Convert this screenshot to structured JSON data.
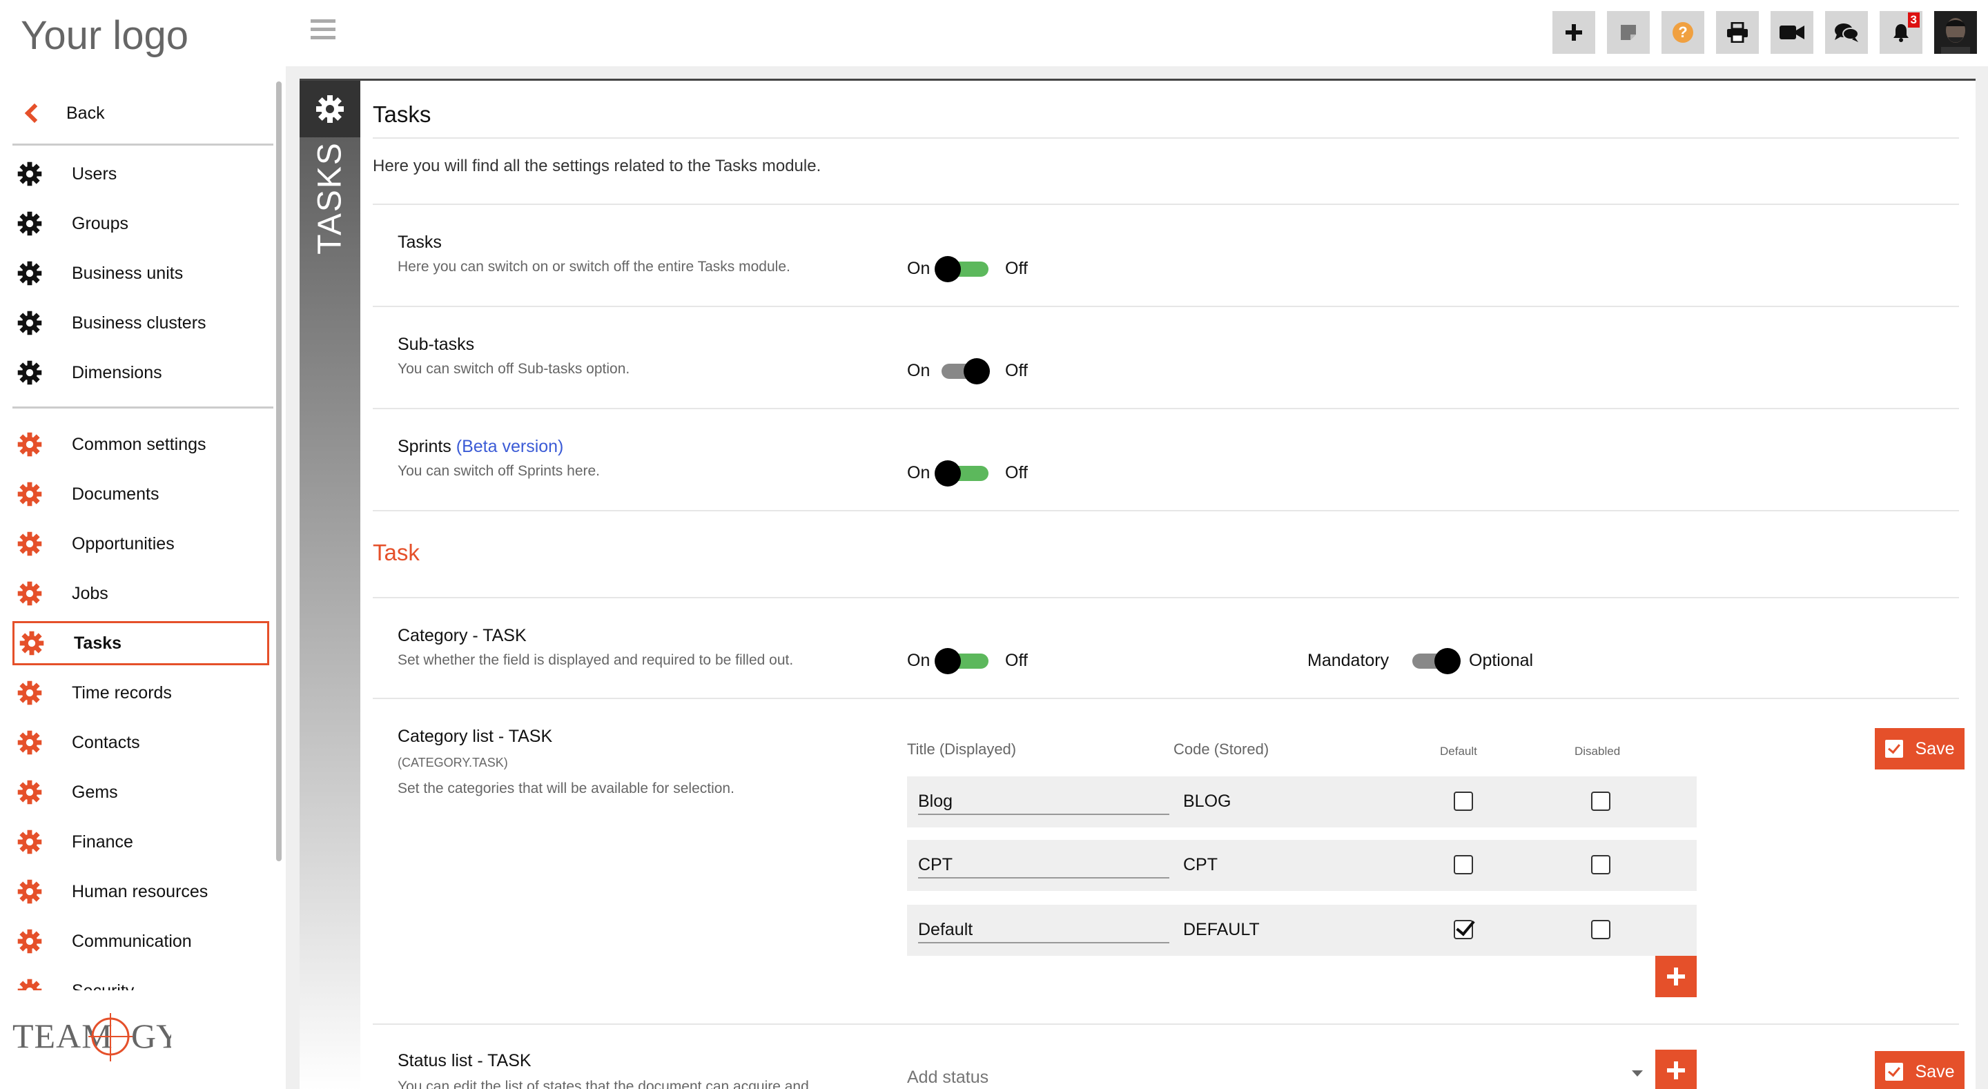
{
  "brand": {
    "logo_text": "Your logo",
    "footer_logo": "TEAMOGY"
  },
  "colors": {
    "accent": "#e5502a",
    "toggle_on": "#5cb85c",
    "toggle_off": "#888888",
    "link": "#3b5bd6"
  },
  "sidebar": {
    "back_label": "Back",
    "items": [
      {
        "label": "Users",
        "icon": "gear-icon",
        "icon_color": "#111111"
      },
      {
        "label": "Groups",
        "icon": "gear-icon",
        "icon_color": "#111111"
      },
      {
        "label": "Business units",
        "icon": "gear-icon",
        "icon_color": "#111111"
      },
      {
        "label": "Business clusters",
        "icon": "gear-icon",
        "icon_color": "#111111"
      },
      {
        "label": "Dimensions",
        "icon": "gear-icon",
        "icon_color": "#111111"
      },
      {
        "label": "Common settings",
        "icon": "gear-icon",
        "icon_color": "#e5502a"
      },
      {
        "label": "Documents",
        "icon": "gear-icon",
        "icon_color": "#e5502a"
      },
      {
        "label": "Opportunities",
        "icon": "gear-icon",
        "icon_color": "#e5502a"
      },
      {
        "label": "Jobs",
        "icon": "gear-icon",
        "icon_color": "#e5502a"
      },
      {
        "label": "Tasks",
        "icon": "gear-icon",
        "icon_color": "#e5502a",
        "active": true
      },
      {
        "label": "Time records",
        "icon": "gear-icon",
        "icon_color": "#e5502a"
      },
      {
        "label": "Contacts",
        "icon": "gear-icon",
        "icon_color": "#e5502a"
      },
      {
        "label": "Gems",
        "icon": "gear-icon",
        "icon_color": "#e5502a"
      },
      {
        "label": "Finance",
        "icon": "gear-icon",
        "icon_color": "#e5502a"
      },
      {
        "label": "Human resources",
        "icon": "gear-icon",
        "icon_color": "#e5502a"
      },
      {
        "label": "Communication",
        "icon": "gear-icon",
        "icon_color": "#e5502a"
      },
      {
        "label": "Security",
        "icon": "gear-icon",
        "icon_color": "#e5502a"
      }
    ]
  },
  "topbar": {
    "buttons": [
      {
        "name": "add-button",
        "icon": "plus-icon"
      },
      {
        "name": "notes-button",
        "icon": "sticky-note-icon"
      },
      {
        "name": "help-button",
        "icon": "question-icon"
      },
      {
        "name": "print-button",
        "icon": "printer-icon"
      },
      {
        "name": "video-button",
        "icon": "video-camera-icon"
      },
      {
        "name": "chat-button",
        "icon": "chat-icon"
      },
      {
        "name": "notifications-button",
        "icon": "bell-icon"
      }
    ],
    "notification_count": "3"
  },
  "panel": {
    "vertical_tab": "TASKS",
    "title": "Tasks",
    "intro": "Here you will find all the settings related to the Tasks module."
  },
  "settings": {
    "tasks": {
      "title": "Tasks",
      "desc": "Here you can switch on or switch off the entire Tasks module.",
      "on_label": "On",
      "off_label": "Off",
      "state": "on"
    },
    "subtasks": {
      "title": "Sub-tasks",
      "desc": "You can switch off Sub-tasks option.",
      "on_label": "On",
      "off_label": "Off",
      "state": "off"
    },
    "sprints": {
      "title": "Sprints",
      "beta": "(Beta version)",
      "desc": "You can switch off Sprints here.",
      "on_label": "On",
      "off_label": "Off",
      "state": "on"
    }
  },
  "task_section": {
    "heading": "Task",
    "category": {
      "title": "Category - TASK",
      "desc": "Set whether the field is displayed and required to be filled out.",
      "on_label": "On",
      "off_label": "Off",
      "state": "on",
      "mandatory_label": "Mandatory",
      "optional_label": "Optional",
      "requirement_state": "optional"
    },
    "category_list": {
      "title": "Category list - TASK",
      "code": "(CATEGORY.TASK)",
      "desc": "Set the categories that will be available for selection.",
      "col_title": "Title (Displayed)",
      "col_code": "Code (Stored)",
      "col_default": "Default",
      "col_disabled": "Disabled",
      "save_label": "Save",
      "rows": [
        {
          "title": "Blog",
          "code": "BLOG",
          "default": false,
          "disabled": false
        },
        {
          "title": "CPT",
          "code": "CPT",
          "default": false,
          "disabled": false
        },
        {
          "title": "Default",
          "code": "DEFAULT",
          "default": true,
          "disabled": false
        }
      ]
    },
    "status_list": {
      "title": "Status list - TASK",
      "desc": "You can edit the list of states that the document can acquire and",
      "placeholder": "Add status",
      "save_label": "Save"
    }
  }
}
